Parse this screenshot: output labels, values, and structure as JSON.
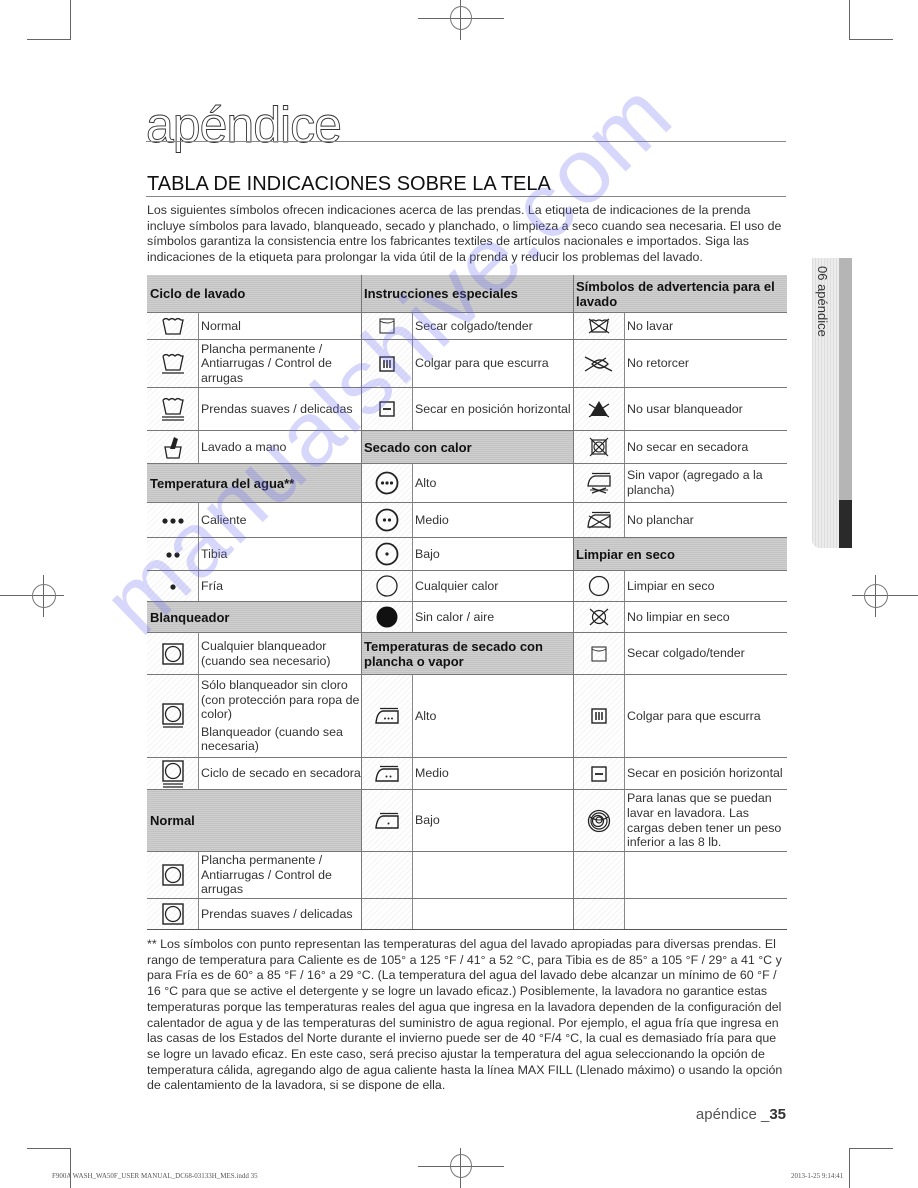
{
  "page": {
    "title": "apéndice",
    "section_title": "TABLA DE INDICACIONES SOBRE LA TELA",
    "intro": "Los siguientes símbolos ofrecen indicaciones acerca de las prendas. La etiqueta de indicaciones de la prenda incluye símbolos para lavado, blanqueado, secado y planchado, o limpieza a seco cuando sea necesaria. El uso de símbolos garantiza la consistencia entre los fabricantes textiles de artículos nacionales e importados. Siga las indicaciones de la etiqueta para prolongar la vida útil de la prenda y reducir los problemas del lavado.",
    "side_tab": "06 apéndice",
    "page_label": "apéndice _",
    "page_number": "35",
    "slug": "F900A WASH_WA50F_USER MANUAL_DC68-03133H_MES.indd   35",
    "timestamp": "2013-1-25   9:14:41",
    "watermark": "manualshive.com"
  },
  "table": {
    "col1": {
      "header_wash": "Ciclo de lavado",
      "wash": [
        {
          "icon": "washtub-normal-icon",
          "label": "Normal"
        },
        {
          "icon": "washtub-permanent-press-icon",
          "label": "Plancha permanente / Antiarrugas / Control de arrugas"
        },
        {
          "icon": "washtub-delicate-icon",
          "label": "Prendas suaves / delicadas"
        },
        {
          "icon": "hand-wash-icon",
          "label": "Lavado a mano"
        }
      ],
      "header_temp": "Temperatura del agua**",
      "temp": [
        {
          "icon": "three-dots-icon",
          "label": "Caliente"
        },
        {
          "icon": "two-dots-icon",
          "label": "Tibia"
        },
        {
          "icon": "one-dot-icon",
          "label": "Fría"
        }
      ],
      "header_bleach": "Blanqueador",
      "bleach": [
        {
          "icon": "tumble-any-icon",
          "label": "Cualquier blanqueador (cuando sea necesario)"
        },
        {
          "icon": "tumble-nonchlorine-icon",
          "label": "Sólo blanqueador sin cloro (con protección para ropa de color)",
          "label2": "Blanqueador (cuando sea necesaria)"
        },
        {
          "icon": "tumble-dry-cycle-icon",
          "label": "Ciclo de secado en secadora"
        }
      ],
      "header_normal": "Normal",
      "normal": [
        {
          "icon": "tumble-permanent-press-icon",
          "label": "Plancha permanente / Antiarrugas / Control de arrugas"
        },
        {
          "icon": "tumble-delicate-icon",
          "label": "Prendas suaves / delicadas"
        }
      ]
    },
    "col2": {
      "header_special": "Instrucciones especiales",
      "special": [
        {
          "icon": "line-dry-icon",
          "label": "Secar colgado/tender"
        },
        {
          "icon": "drip-dry-icon",
          "label": "Colgar para que escurra"
        },
        {
          "icon": "dry-flat-icon",
          "label": "Secar en posición horizontal"
        }
      ],
      "header_heat": "Secado con calor",
      "heat": [
        {
          "icon": "dry-high-icon",
          "label": "Alto"
        },
        {
          "icon": "dry-medium-icon",
          "label": "Medio"
        },
        {
          "icon": "dry-low-icon",
          "label": "Bajo"
        },
        {
          "icon": "dry-any-heat-icon",
          "label": "Cualquier calor"
        },
        {
          "icon": "dry-no-heat-icon",
          "label": "Sin calor / aire"
        }
      ],
      "header_iron": "Temperaturas de secado con plancha o vapor",
      "iron": [
        {
          "icon": "iron-high-icon",
          "label": "Alto"
        },
        {
          "icon": "iron-medium-icon",
          "label": "Medio"
        },
        {
          "icon": "iron-low-icon",
          "label": "Bajo"
        }
      ]
    },
    "col3": {
      "header_warning": "Símbolos de advertencia para el lavado",
      "warning": [
        {
          "icon": "do-not-wash-icon",
          "label": "No lavar"
        },
        {
          "icon": "do-not-wring-icon",
          "label": "No retorcer"
        },
        {
          "icon": "do-not-bleach-icon",
          "label": "No usar blanqueador"
        },
        {
          "icon": "do-not-tumble-dry-icon",
          "label": "No secar en secadora"
        },
        {
          "icon": "no-steam-icon",
          "label": "Sin vapor (agregado a la plancha)"
        },
        {
          "icon": "do-not-iron-icon",
          "label": "No planchar"
        }
      ],
      "header_dryclean": "Limpiar en seco",
      "dryclean": [
        {
          "icon": "dry-clean-icon",
          "label": "Limpiar en seco"
        },
        {
          "icon": "do-not-dry-clean-icon",
          "label": "No limpiar en seco"
        },
        {
          "icon": "line-dry-icon",
          "label": "Secar colgado/tender"
        },
        {
          "icon": "drip-dry-icon",
          "label": "Colgar para que escurra"
        },
        {
          "icon": "dry-flat-icon",
          "label": "Secar en posición horizontal"
        },
        {
          "icon": "wool-icon",
          "label": "Para lanas que se puedan lavar en lavadora. Las cargas deben tener un peso inferior a las 8 lb."
        }
      ]
    }
  },
  "footnote": "** Los símbolos con punto representan las temperaturas del agua del lavado apropiadas para diversas prendas. El rango de temperatura para Caliente es de 105° a 125 °F / 41° a 52 °C, para Tibia es de 85° a 105 °F / 29° a 41 °C y para Fría es de 60° a 85 °F / 16° a 29 °C. (La temperatura del agua del lavado debe alcanzar un mínimo de 60 °F / 16 °C para que se active el detergente y se logre un lavado eficaz.) Posiblemente, la lavadora no garantice estas temperaturas porque las temperaturas reales del agua que ingresa en la lavadora dependen de la configuración del calentador de agua y de las temperaturas del suministro de agua regional. Por ejemplo, el agua fría que ingresa en las casas de los Estados del Norte durante el invierno puede ser de 40 °F/4 °C, la cual es demasiado fría para que se logre un lavado eficaz. En este caso, será preciso ajustar la temperatura del agua seleccionando la opción de temperatura cálida, agregando algo de agua caliente hasta la línea MAX FILL (Llenado máximo) o usando la opción de calentamiento de la lavadora, si se dispone de ella."
}
